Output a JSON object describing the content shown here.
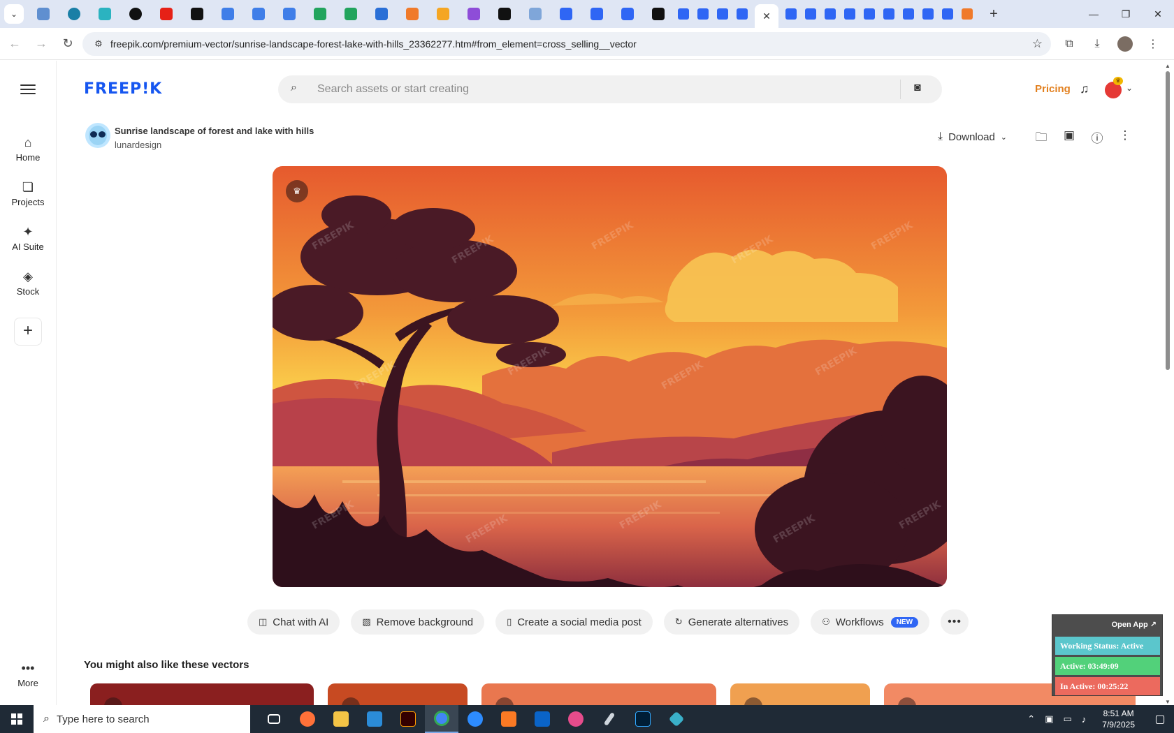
{
  "browser": {
    "active_tab_close": "✕",
    "new_tab": "+",
    "url": "freepik.com/premium-vector/sunrise-landscape-forest-lake-with-hills_23362277.htm#from_element=cross_selling__vector"
  },
  "sidebar": {
    "items": [
      {
        "label": "Home",
        "icon": "home-icon"
      },
      {
        "label": "Projects",
        "icon": "projects-icon"
      },
      {
        "label": "AI Suite",
        "icon": "sparkle-icon"
      },
      {
        "label": "Stock",
        "icon": "stock-icon"
      }
    ],
    "more_label": "More"
  },
  "header": {
    "logo": "FREEP!K",
    "search_placeholder": "Search assets or start creating",
    "pricing": "Pricing"
  },
  "asset": {
    "title": "Sunrise landscape of forest and lake with hills",
    "author": "lunardesign",
    "download_label": "Download"
  },
  "actions": [
    {
      "label": "Chat with AI",
      "icon": "chat-icon"
    },
    {
      "label": "Remove background",
      "icon": "remove-bg-icon"
    },
    {
      "label": "Create a social media post",
      "icon": "phone-icon"
    },
    {
      "label": "Generate alternatives",
      "icon": "refresh-icon"
    },
    {
      "label": "Workflows",
      "icon": "workflow-icon",
      "badge": "NEW"
    }
  ],
  "related": {
    "heading": "You might also like these vectors"
  },
  "widget": {
    "open_app": "Open App ↗",
    "working_status": "Working Status: Active",
    "active": "Active: 03:49:09",
    "inactive": "In Active: 00:25:22",
    "colors": {
      "status": "#5bc6cc",
      "active": "#52d17a",
      "inactive": "#ec6a5e"
    }
  },
  "taskbar": {
    "search_placeholder": "Type here to search",
    "time": "8:51 AM",
    "date": "7/9/2025"
  },
  "colors": {
    "brand": "#1656f0",
    "pricing": "#e2801f",
    "badge": "#2f66f4"
  }
}
